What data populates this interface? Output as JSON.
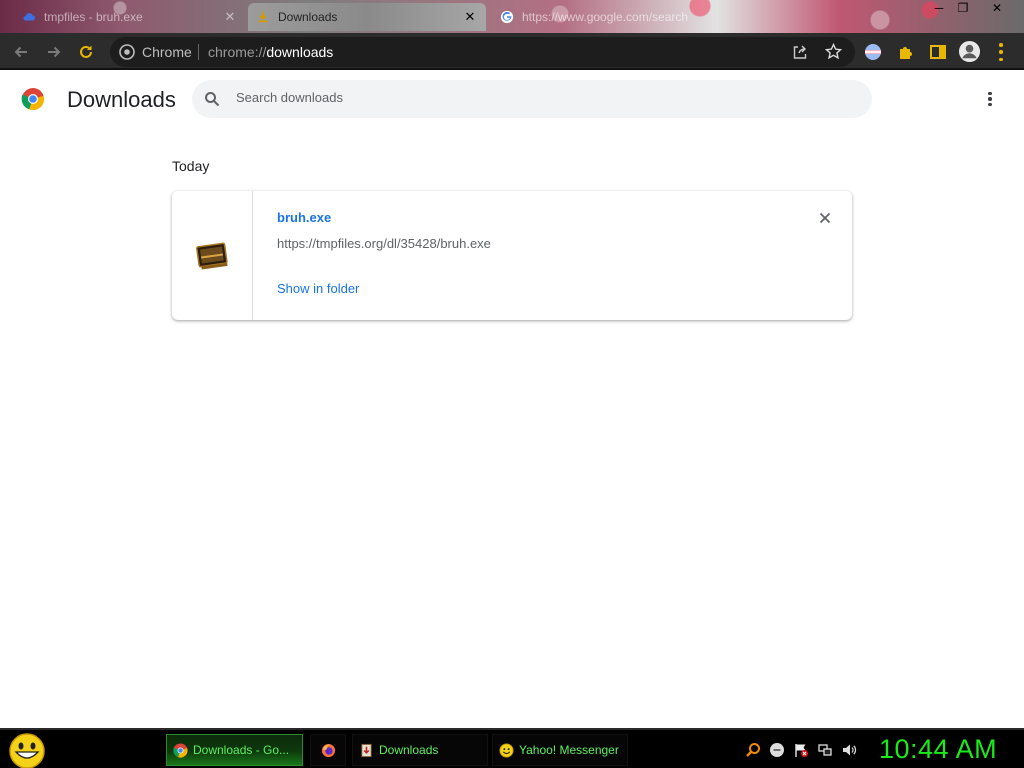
{
  "browser": {
    "tabs": [
      {
        "label": "tmpfiles - bruh.exe",
        "icon": "cloud-icon",
        "active": false
      },
      {
        "label": "Downloads",
        "icon": "download-icon",
        "active": true
      },
      {
        "label": "https://www.google.com/search",
        "icon": "google-icon",
        "active": false
      }
    ],
    "omnibox": {
      "site": "Chrome",
      "url_prefix": "chrome://",
      "url_path": "downloads"
    }
  },
  "page": {
    "title": "Downloads",
    "search_placeholder": "Search downloads",
    "section_date": "Today",
    "download": {
      "file_name": "bruh.exe",
      "url": "https://tmpfiles.org/dl/35428/bruh.exe",
      "action_label": "Show in folder"
    }
  },
  "taskbar": {
    "items": [
      {
        "label": "Downloads - Go...",
        "icon": "chrome-icon",
        "active": true
      },
      {
        "label": "",
        "icon": "firefox-icon",
        "active": false
      },
      {
        "label": "Downloads",
        "icon": "folder-icon",
        "active": false
      },
      {
        "label": "Yahoo! Messenger",
        "icon": "yahoo-messenger-icon",
        "active": false
      }
    ],
    "clock": "10:44 AM"
  },
  "colors": {
    "accent": "#1a73e8",
    "taskbar_text": "#5ef062",
    "clock": "#1bea1b",
    "toolbar": "#2c2c2c"
  }
}
